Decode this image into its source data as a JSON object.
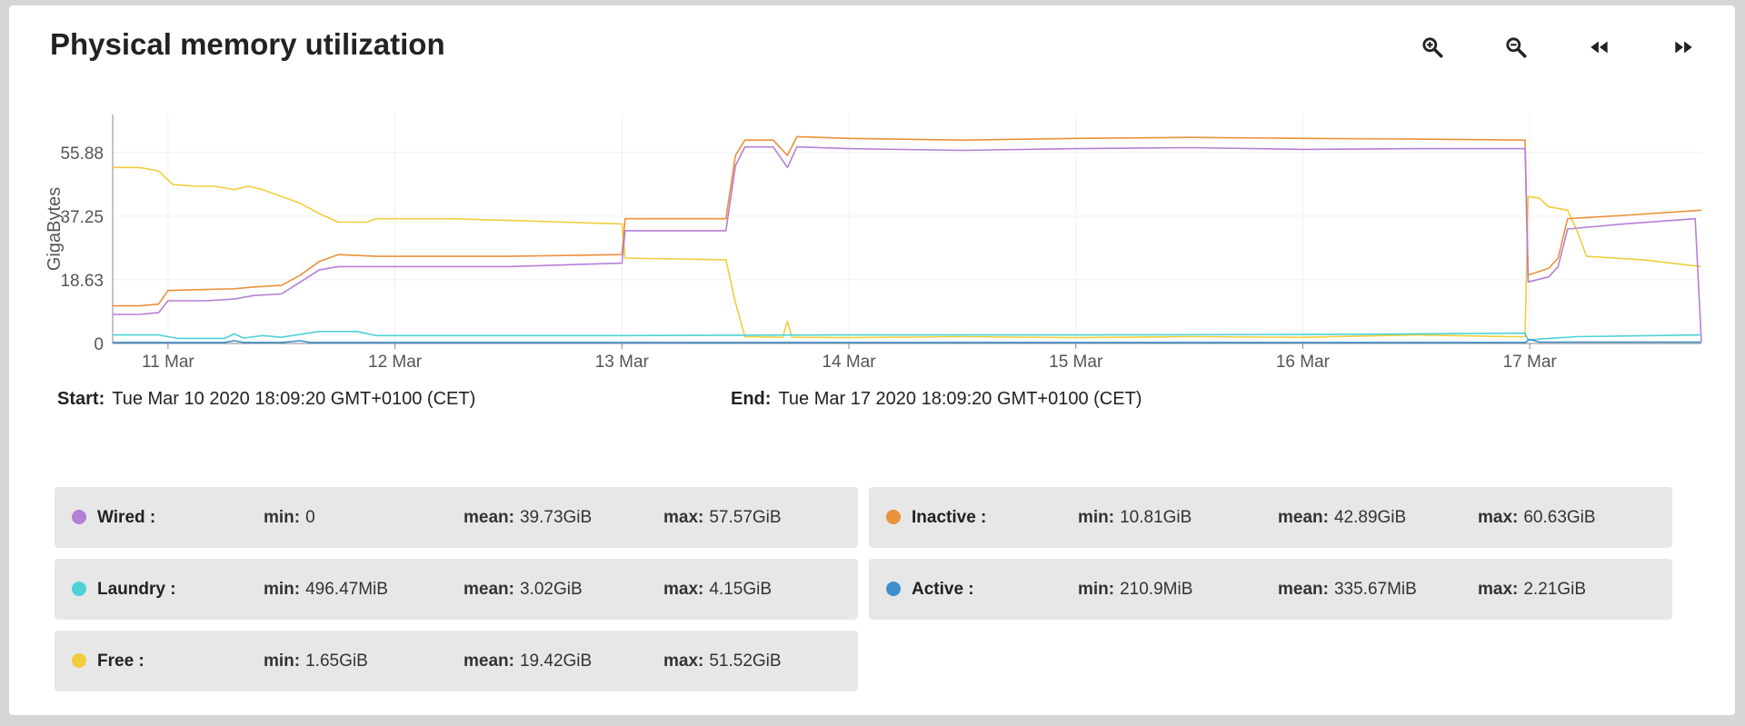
{
  "title": "Physical memory utilization",
  "toolbar": {
    "zoom_in": "zoom-in-icon",
    "zoom_out": "zoom-out-icon",
    "back": "rewind-icon",
    "forward": "fast-forward-icon"
  },
  "start": {
    "label": "Start:",
    "value": "Tue Mar 10 2020 18:09:20 GMT+0100 (CET)"
  },
  "end": {
    "label": "End:",
    "value": "Tue Mar 17 2020 18:09:20 GMT+0100 (CET)"
  },
  "chart_data": {
    "type": "line",
    "ylabel": "GigaBytes",
    "yticks": [
      "0",
      "18.63",
      "37.25",
      "55.88"
    ],
    "ytick_values": [
      0,
      18.63,
      37.25,
      55.88
    ],
    "ylim": [
      0,
      67
    ],
    "xlim": [
      "2020-03-10T18:09",
      "2020-03-17T18:09"
    ],
    "xticks": [
      "11 Mar",
      "12 Mar",
      "13 Mar",
      "14 Mar",
      "15 Mar",
      "16 Mar",
      "17 Mar"
    ],
    "xtick_values": [
      "2020-03-11T00:00",
      "2020-03-12T00:00",
      "2020-03-13T00:00",
      "2020-03-14T00:00",
      "2020-03-15T00:00",
      "2020-03-16T00:00",
      "2020-03-17T00:00"
    ],
    "grid": true,
    "series": [
      {
        "name": "Free",
        "color": "#f0ce3c",
        "points": [
          [
            "2020-03-10T18:09",
            51.5
          ],
          [
            "2020-03-10T21:00",
            51.5
          ],
          [
            "2020-03-10T23:00",
            50.5
          ],
          [
            "2020-03-11T00:30",
            46.5
          ],
          [
            "2020-03-11T03:00",
            46.0
          ],
          [
            "2020-03-11T05:00",
            46.0
          ],
          [
            "2020-03-11T07:00",
            45.0
          ],
          [
            "2020-03-11T08:30",
            46.0
          ],
          [
            "2020-03-11T10:00",
            45.0
          ],
          [
            "2020-03-11T12:00",
            43.0
          ],
          [
            "2020-03-11T14:00",
            41.0
          ],
          [
            "2020-03-11T16:00",
            38.0
          ],
          [
            "2020-03-11T18:00",
            35.5
          ],
          [
            "2020-03-11T21:00",
            35.5
          ],
          [
            "2020-03-11T22:00",
            36.5
          ],
          [
            "2020-03-12T06:00",
            36.5
          ],
          [
            "2020-03-12T12:00",
            36.0
          ],
          [
            "2020-03-12T18:00",
            35.5
          ],
          [
            "2020-03-13T00:00",
            35.0
          ],
          [
            "2020-03-13T00:20",
            25.0
          ],
          [
            "2020-03-13T11:00",
            24.5
          ],
          [
            "2020-03-13T12:00",
            12.0
          ],
          [
            "2020-03-13T13:00",
            2.0
          ],
          [
            "2020-03-13T17:00",
            1.8
          ],
          [
            "2020-03-13T17:30",
            6.5
          ],
          [
            "2020-03-13T18:00",
            1.8
          ],
          [
            "2020-03-14T00:00",
            1.7
          ],
          [
            "2020-03-14T12:00",
            2.0
          ],
          [
            "2020-03-15T00:00",
            1.7
          ],
          [
            "2020-03-15T12:00",
            2.0
          ],
          [
            "2020-03-16T00:00",
            1.8
          ],
          [
            "2020-03-16T12:00",
            2.5
          ],
          [
            "2020-03-16T22:00",
            2.0
          ],
          [
            "2020-03-16T23:30",
            2.0
          ],
          [
            "2020-03-16T23:50",
            43.0
          ],
          [
            "2020-03-17T01:00",
            42.5
          ],
          [
            "2020-03-17T02:00",
            40.0
          ],
          [
            "2020-03-17T04:00",
            39.0
          ],
          [
            "2020-03-17T05:00",
            33.0
          ],
          [
            "2020-03-17T06:00",
            25.5
          ],
          [
            "2020-03-17T12:00",
            24.5
          ],
          [
            "2020-03-17T18:09",
            22.5
          ]
        ]
      },
      {
        "name": "Inactive",
        "color": "#eb913a",
        "points": [
          [
            "2020-03-10T18:09",
            11.0
          ],
          [
            "2020-03-10T21:00",
            11.0
          ],
          [
            "2020-03-10T23:00",
            11.5
          ],
          [
            "2020-03-11T00:00",
            15.5
          ],
          [
            "2020-03-11T04:00",
            15.8
          ],
          [
            "2020-03-11T07:00",
            16.0
          ],
          [
            "2020-03-11T09:00",
            16.5
          ],
          [
            "2020-03-11T12:00",
            17.0
          ],
          [
            "2020-03-11T14:00",
            20.0
          ],
          [
            "2020-03-11T16:00",
            24.0
          ],
          [
            "2020-03-11T18:00",
            26.0
          ],
          [
            "2020-03-11T22:00",
            25.5
          ],
          [
            "2020-03-12T12:00",
            25.5
          ],
          [
            "2020-03-13T00:00",
            26.0
          ],
          [
            "2020-03-13T00:20",
            36.5
          ],
          [
            "2020-03-13T11:00",
            36.5
          ],
          [
            "2020-03-13T12:00",
            55.0
          ],
          [
            "2020-03-13T13:00",
            59.5
          ],
          [
            "2020-03-13T16:00",
            59.5
          ],
          [
            "2020-03-13T17:30",
            55.0
          ],
          [
            "2020-03-13T18:30",
            60.5
          ],
          [
            "2020-03-14T00:00",
            60.0
          ],
          [
            "2020-03-14T12:00",
            59.5
          ],
          [
            "2020-03-15T00:00",
            60.0
          ],
          [
            "2020-03-15T12:00",
            60.3
          ],
          [
            "2020-03-16T00:00",
            60.0
          ],
          [
            "2020-03-16T12:00",
            59.8
          ],
          [
            "2020-03-16T23:30",
            59.5
          ],
          [
            "2020-03-16T23:50",
            20.0
          ],
          [
            "2020-03-17T02:00",
            22.0
          ],
          [
            "2020-03-17T03:00",
            25.0
          ],
          [
            "2020-03-17T04:00",
            36.5
          ],
          [
            "2020-03-17T10:00",
            37.5
          ],
          [
            "2020-03-17T18:09",
            39.0
          ]
        ]
      },
      {
        "name": "Wired",
        "color": "#b57fd6",
        "points": [
          [
            "2020-03-10T18:09",
            8.5
          ],
          [
            "2020-03-10T21:00",
            8.5
          ],
          [
            "2020-03-10T23:00",
            9.0
          ],
          [
            "2020-03-11T00:00",
            12.5
          ],
          [
            "2020-03-11T04:00",
            12.5
          ],
          [
            "2020-03-11T07:00",
            13.0
          ],
          [
            "2020-03-11T09:00",
            14.0
          ],
          [
            "2020-03-11T12:00",
            14.5
          ],
          [
            "2020-03-11T14:00",
            18.0
          ],
          [
            "2020-03-11T16:00",
            21.5
          ],
          [
            "2020-03-11T18:00",
            22.5
          ],
          [
            "2020-03-12T12:00",
            22.5
          ],
          [
            "2020-03-13T00:00",
            23.5
          ],
          [
            "2020-03-13T00:20",
            33.0
          ],
          [
            "2020-03-13T11:00",
            33.0
          ],
          [
            "2020-03-13T12:00",
            52.0
          ],
          [
            "2020-03-13T13:00",
            57.5
          ],
          [
            "2020-03-13T16:00",
            57.5
          ],
          [
            "2020-03-13T17:30",
            51.5
          ],
          [
            "2020-03-13T18:30",
            57.5
          ],
          [
            "2020-03-14T00:00",
            57.0
          ],
          [
            "2020-03-14T12:00",
            56.5
          ],
          [
            "2020-03-15T00:00",
            57.0
          ],
          [
            "2020-03-15T12:00",
            57.3
          ],
          [
            "2020-03-16T00:00",
            56.8
          ],
          [
            "2020-03-16T12:00",
            57.0
          ],
          [
            "2020-03-16T23:30",
            57.0
          ],
          [
            "2020-03-16T23:50",
            18.0
          ],
          [
            "2020-03-17T02:00",
            19.5
          ],
          [
            "2020-03-17T03:00",
            22.5
          ],
          [
            "2020-03-17T04:00",
            33.5
          ],
          [
            "2020-03-17T10:00",
            35.0
          ],
          [
            "2020-03-17T17:30",
            36.5
          ],
          [
            "2020-03-17T18:09",
            0.5
          ]
        ]
      },
      {
        "name": "Laundry",
        "color": "#4ed2d8",
        "points": [
          [
            "2020-03-10T18:09",
            2.5
          ],
          [
            "2020-03-10T23:00",
            2.5
          ],
          [
            "2020-03-11T01:00",
            1.5
          ],
          [
            "2020-03-11T06:00",
            1.5
          ],
          [
            "2020-03-11T07:00",
            2.8
          ],
          [
            "2020-03-11T08:00",
            1.6
          ],
          [
            "2020-03-11T10:00",
            2.3
          ],
          [
            "2020-03-11T12:00",
            1.8
          ],
          [
            "2020-03-11T16:00",
            3.5
          ],
          [
            "2020-03-11T20:00",
            3.5
          ],
          [
            "2020-03-11T22:00",
            2.3
          ],
          [
            "2020-03-13T00:00",
            2.3
          ],
          [
            "2020-03-14T00:00",
            2.5
          ],
          [
            "2020-03-15T00:00",
            2.5
          ],
          [
            "2020-03-16T00:00",
            2.6
          ],
          [
            "2020-03-16T23:30",
            3.0
          ],
          [
            "2020-03-16T23:50",
            1.0
          ],
          [
            "2020-03-17T02:00",
            1.5
          ],
          [
            "2020-03-17T05:00",
            2.0
          ],
          [
            "2020-03-17T18:09",
            2.5
          ]
        ]
      },
      {
        "name": "Active",
        "color": "#3f8fce",
        "points": [
          [
            "2020-03-10T18:09",
            0.3
          ],
          [
            "2020-03-11T06:00",
            0.3
          ],
          [
            "2020-03-11T07:00",
            0.8
          ],
          [
            "2020-03-11T08:00",
            0.3
          ],
          [
            "2020-03-11T12:00",
            0.3
          ],
          [
            "2020-03-11T14:00",
            0.8
          ],
          [
            "2020-03-11T15:00",
            0.3
          ],
          [
            "2020-03-13T00:00",
            0.3
          ],
          [
            "2020-03-16T23:30",
            0.3
          ],
          [
            "2020-03-17T00:00",
            1.2
          ],
          [
            "2020-03-17T01:00",
            0.4
          ],
          [
            "2020-03-17T18:09",
            0.4
          ]
        ]
      }
    ]
  },
  "legend": [
    {
      "name": "Wired :",
      "color": "#b57fd6",
      "min_label": "min:",
      "min": "0",
      "mean_label": "mean:",
      "mean": "39.73GiB",
      "max_label": "max:",
      "max": "57.57GiB"
    },
    {
      "name": "Inactive :",
      "color": "#eb913a",
      "min_label": "min:",
      "min": "10.81GiB",
      "mean_label": "mean:",
      "mean": "42.89GiB",
      "max_label": "max:",
      "max": "60.63GiB"
    },
    {
      "name": "Laundry :",
      "color": "#4ed2d8",
      "min_label": "min:",
      "min": "496.47MiB",
      "mean_label": "mean:",
      "mean": "3.02GiB",
      "max_label": "max:",
      "max": "4.15GiB"
    },
    {
      "name": "Active :",
      "color": "#3f8fce",
      "min_label": "min:",
      "min": "210.9MiB",
      "mean_label": "mean:",
      "mean": "335.67MiB",
      "max_label": "max:",
      "max": "2.21GiB"
    },
    {
      "name": "Free :",
      "color": "#f0ce3c",
      "min_label": "min:",
      "min": "1.65GiB",
      "mean_label": "mean:",
      "mean": "19.42GiB",
      "max_label": "max:",
      "max": "51.52GiB"
    }
  ]
}
